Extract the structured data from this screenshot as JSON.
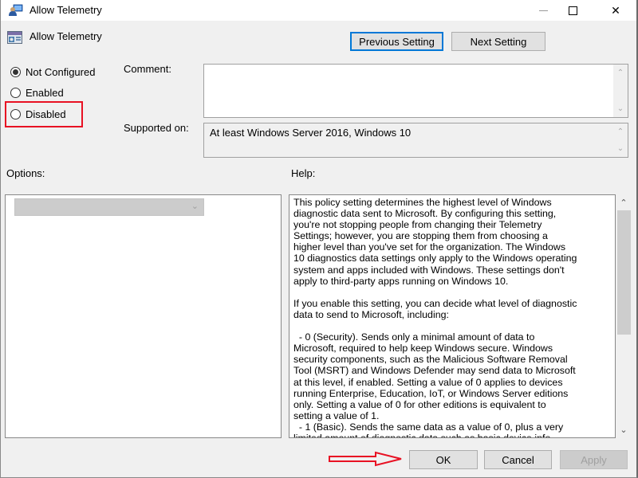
{
  "window": {
    "title": "Allow Telemetry",
    "controls": {
      "minimize": "minimize",
      "maximize": "maximize",
      "close": "✕"
    }
  },
  "header": {
    "setting_name": "Allow Telemetry",
    "previous_label": "Previous Setting",
    "next_label": "Next Setting"
  },
  "state": {
    "options": [
      {
        "label": "Not Configured",
        "selected": true
      },
      {
        "label": "Enabled",
        "selected": false
      },
      {
        "label": "Disabled",
        "selected": false
      }
    ],
    "highlighted_option": "Disabled",
    "highlight_color": "#e81123"
  },
  "fields": {
    "comment_label": "Comment:",
    "comment_value": "",
    "supported_label": "Supported on:",
    "supported_value": "At least Windows Server 2016, Windows 10"
  },
  "panels": {
    "options_label": "Options:",
    "options_select_value": "",
    "help_label": "Help:",
    "help_text": "This policy setting determines the highest level of Windows\ndiagnostic data sent to Microsoft. By configuring this setting,\nyou're not stopping people from changing their Telemetry\nSettings; however, you are stopping them from choosing a\nhigher level than you've set for the organization. The Windows\n10 diagnostics data settings only apply to the Windows operating\nsystem and apps included with Windows. These settings don't\napply to third-party apps running on Windows 10.\n\nIf you enable this setting, you can decide what level of diagnostic\ndata to send to Microsoft, including:\n\n  - 0 (Security). Sends only a minimal amount of data to\nMicrosoft, required to help keep Windows secure. Windows\nsecurity components, such as the Malicious Software Removal\nTool (MSRT) and Windows Defender may send data to Microsoft\nat this level, if enabled. Setting a value of 0 applies to devices\nrunning Enterprise, Education, IoT, or Windows Server editions\nonly. Setting a value of 0 for other editions is equivalent to\nsetting a value of 1.\n  - 1 (Basic). Sends the same data as a value of 0, plus a very\nlimited amount of diagnostic data such as basic device info"
  },
  "footer": {
    "ok_label": "OK",
    "cancel_label": "Cancel",
    "apply_label": "Apply",
    "annotation_arrow_color": "#e81123"
  },
  "colors": {
    "accent": "#0078d7",
    "dialog_bg": "#f0f0f0"
  }
}
